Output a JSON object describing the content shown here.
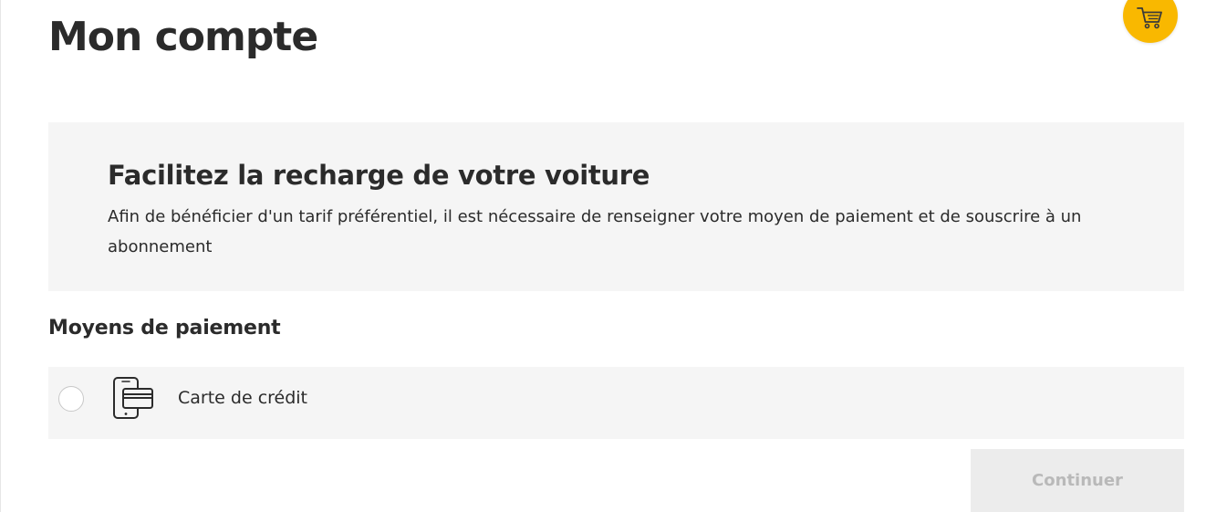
{
  "page": {
    "title": "Mon compte"
  },
  "header": {
    "cart_icon": "shopping-cart-icon",
    "cart_color": "#f9b800"
  },
  "info_box": {
    "title": "Facilitez la recharge de votre voiture",
    "text": "Afin de bénéficier d'un tarif préférentiel, il est nécessaire de renseigner votre moyen de paiement et de souscrire à un abonnement"
  },
  "payment": {
    "section_title": "Moyens de paiement",
    "options": [
      {
        "label": "Carte de crédit",
        "icon": "credit-card-phone-icon",
        "selected": false
      }
    ]
  },
  "actions": {
    "continue_label": "Continuer",
    "continue_disabled": true
  }
}
